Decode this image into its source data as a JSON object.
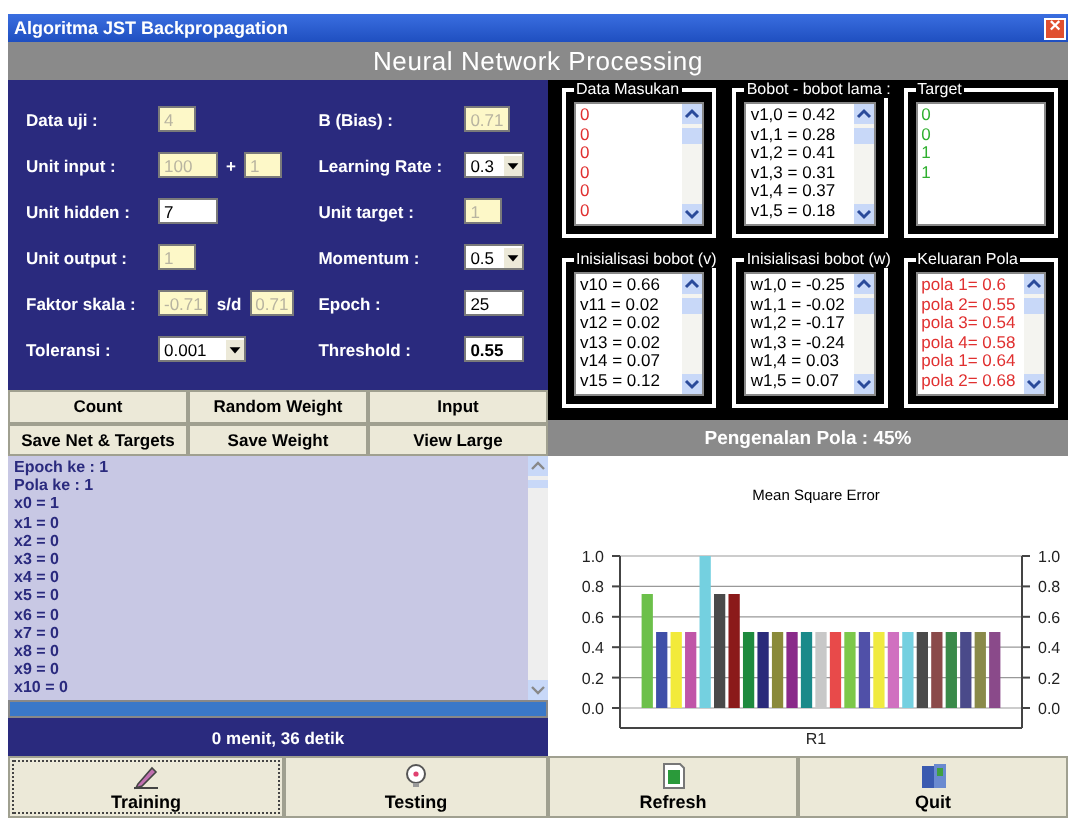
{
  "window": {
    "title": "Algoritma JST Backpropagation",
    "close": "×"
  },
  "header": "Neural Network Processing",
  "params": [
    {
      "label": "Data uji :",
      "controls": [
        {
          "kind": "input",
          "value": "4",
          "disabled": true
        }
      ]
    },
    {
      "label": "B (Bias) :",
      "controls": [
        {
          "kind": "input",
          "value": "0.71",
          "disabled": true
        }
      ]
    },
    {
      "label": "Unit input :",
      "controls": [
        {
          "kind": "input",
          "value": "100",
          "disabled": true,
          "wide": true
        },
        {
          "kind": "sep",
          "text": "+"
        },
        {
          "kind": "input",
          "value": "1",
          "disabled": true
        }
      ]
    },
    {
      "label": "Learning Rate :",
      "controls": [
        {
          "kind": "select",
          "value": "0.3"
        }
      ]
    },
    {
      "label": "Unit hidden :",
      "controls": [
        {
          "kind": "input",
          "value": "7",
          "disabled": false,
          "wide": true
        }
      ]
    },
    {
      "label": "Unit target :",
      "controls": [
        {
          "kind": "input",
          "value": "1",
          "disabled": true
        }
      ]
    },
    {
      "label": "Unit output :",
      "controls": [
        {
          "kind": "input",
          "value": "1",
          "disabled": true
        }
      ]
    },
    {
      "label": "Momentum :",
      "controls": [
        {
          "kind": "select",
          "value": "0.5"
        }
      ]
    },
    {
      "label": "Faktor skala :",
      "controls": [
        {
          "kind": "input",
          "value": "-0.71",
          "disabled": true
        },
        {
          "kind": "sep",
          "text": "s/d"
        },
        {
          "kind": "input",
          "value": "0.71",
          "disabled": true
        }
      ]
    },
    {
      "label": "Epoch :",
      "controls": [
        {
          "kind": "input",
          "value": "25",
          "disabled": false,
          "wide": true
        }
      ]
    },
    {
      "label": "Toleransi :",
      "controls": [
        {
          "kind": "select",
          "value": "0.001",
          "wide": true
        }
      ]
    },
    {
      "label": "Threshold :",
      "controls": [
        {
          "kind": "input",
          "value": "0.55",
          "disabled": false,
          "wide": true,
          "bold": true
        }
      ]
    }
  ],
  "actions": [
    "Count",
    "Random Weight",
    "Input",
    "Save Net & Targets",
    "Save Weight",
    "View Large"
  ],
  "lists": [
    {
      "title": "Data Masukan",
      "color": "#e03030",
      "scrollbar": true,
      "items": [
        "0",
        "0",
        "0",
        "0",
        "0",
        "0"
      ]
    },
    {
      "title": "Bobot - bobot lama :",
      "color": "#000000",
      "scrollbar": true,
      "items": [
        "v1,0 = 0.42",
        "v1,1 = 0.28",
        "v1,2 = 0.41",
        "v1,3 = 0.31",
        "v1,4 = 0.37",
        "v1,5 = 0.18"
      ]
    },
    {
      "title": "Target",
      "color": "#30b030",
      "scrollbar": false,
      "items": [
        "0",
        "0",
        "1",
        "1"
      ]
    },
    {
      "title": "Inisialisasi bobot (v)",
      "color": "#000000",
      "scrollbar": true,
      "items": [
        "v10 = 0.66",
        "v11 = 0.02",
        "v12 = 0.02",
        "v13 = 0.02",
        "v14 = 0.07",
        "v15 = 0.12"
      ]
    },
    {
      "title": "Inisialisasi bobot (w)",
      "color": "#000000",
      "scrollbar": true,
      "items": [
        "w1,0 = -0.25",
        "w1,1 = -0.02",
        "w1,2 = -0.17",
        "w1,3 = -0.24",
        "w1,4 = 0.03",
        "w1,5 = 0.07"
      ]
    },
    {
      "title": "Keluaran Pola",
      "color": "#e03030",
      "scrollbar": true,
      "items": [
        "pola 1= 0.6",
        "pola 2= 0.55",
        "pola 3= 0.54",
        "pola 4= 0.58",
        "pola 1= 0.64",
        "pola 2= 0.68"
      ]
    }
  ],
  "recognition": "Pengenalan Pola : 45%",
  "log": [
    "Epoch ke : 1",
    "Pola ke : 1",
    "x0 = 1",
    "x1 = 0",
    "x2 = 0",
    "x3 = 0",
    "x4 = 0",
    "x5 = 0",
    "x6 = 0",
    "x7 = 0",
    "x8 = 0",
    "x9 = 0",
    "x10 = 0"
  ],
  "elapsed": "0 menit, 36 detik",
  "chart_data": {
    "type": "bar",
    "grid": true,
    "title": "Mean Square Error",
    "categories": [
      "R1"
    ],
    "ylim": [
      0,
      1
    ],
    "yticks": [
      {
        "value": 0,
        "label": "0.0"
      },
      {
        "value": 0.2,
        "label": "0.2"
      },
      {
        "value": 0.4,
        "label": "0.4"
      },
      {
        "value": 0.6,
        "label": "0.6"
      },
      {
        "value": 0.8,
        "label": "0.8"
      },
      {
        "value": 1,
        "label": "1.0"
      }
    ],
    "series": [
      {
        "color": "#6cc04a",
        "values": [
          0.75
        ]
      },
      {
        "color": "#3f4fa8",
        "values": [
          0.5
        ]
      },
      {
        "color": "#f2ea3a",
        "values": [
          0.5
        ]
      },
      {
        "color": "#c055a8",
        "values": [
          0.5
        ]
      },
      {
        "color": "#74d0e0",
        "values": [
          1.0
        ]
      },
      {
        "color": "#4a4a4a",
        "values": [
          0.75
        ]
      },
      {
        "color": "#8b1a1a",
        "values": [
          0.75
        ]
      },
      {
        "color": "#1e8a3e",
        "values": [
          0.5
        ]
      },
      {
        "color": "#2a2a7a",
        "values": [
          0.5
        ]
      },
      {
        "color": "#8a8a3a",
        "values": [
          0.5
        ]
      },
      {
        "color": "#8a2a8a",
        "values": [
          0.5
        ]
      },
      {
        "color": "#1a8a8a",
        "values": [
          0.5
        ]
      },
      {
        "color": "#c8c8c8",
        "values": [
          0.5
        ]
      },
      {
        "color": "#e84a4a",
        "values": [
          0.5
        ]
      },
      {
        "color": "#7cc84a",
        "values": [
          0.5
        ]
      },
      {
        "color": "#5050a8",
        "values": [
          0.5
        ]
      },
      {
        "color": "#f0ea40",
        "values": [
          0.5
        ]
      },
      {
        "color": "#d070c0",
        "values": [
          0.5
        ]
      },
      {
        "color": "#74d0e0",
        "values": [
          0.5
        ]
      },
      {
        "color": "#4a4a4a",
        "values": [
          0.5
        ]
      },
      {
        "color": "#8a4a4a",
        "values": [
          0.5
        ]
      },
      {
        "color": "#3a8a4a",
        "values": [
          0.5
        ]
      },
      {
        "color": "#4a4a8a",
        "values": [
          0.5
        ]
      },
      {
        "color": "#8a8a4a",
        "values": [
          0.5
        ]
      },
      {
        "color": "#8a4a8a",
        "values": [
          0.5
        ]
      }
    ]
  },
  "nav": [
    {
      "label": "Training",
      "kind": "pencil",
      "focused": true
    },
    {
      "label": "Testing",
      "kind": "bulb",
      "focused": false
    },
    {
      "label": "Refresh",
      "kind": "sheet",
      "focused": false
    },
    {
      "label": "Quit",
      "kind": "exit",
      "focused": false
    }
  ]
}
